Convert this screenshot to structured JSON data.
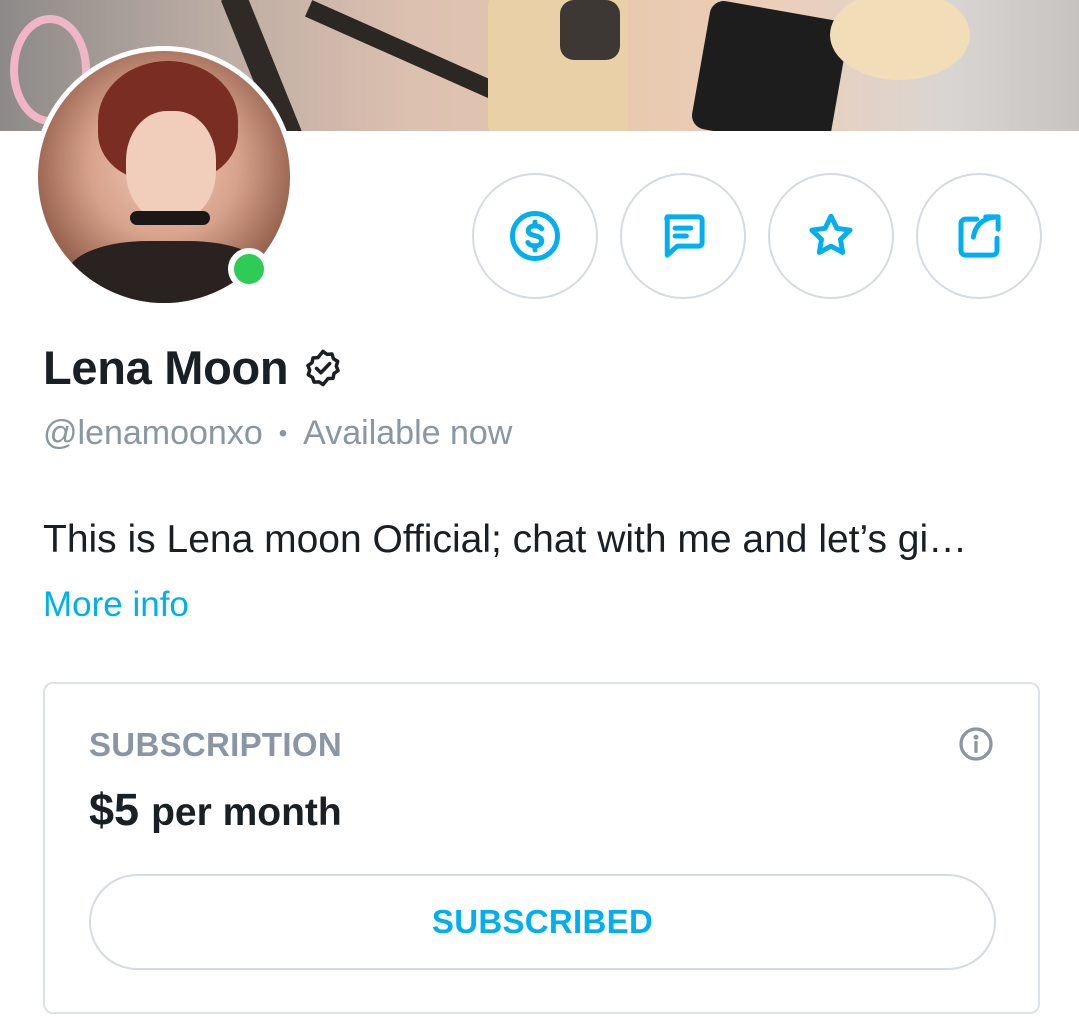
{
  "profile": {
    "name": "Lena Moon",
    "handle": "@lenamoonxo",
    "separator": "•",
    "status": "Available now",
    "bio": "This is Lena moon Official; chat with me and let’s gi…",
    "more_info": "More info",
    "online": true
  },
  "actions": [
    {
      "icon": "dollar-icon"
    },
    {
      "icon": "message-icon"
    },
    {
      "icon": "star-icon"
    },
    {
      "icon": "share-icon"
    }
  ],
  "subscription": {
    "title": "SUBSCRIPTION",
    "price": "$5",
    "period": "per month",
    "button_label": "SUBSCRIBED"
  },
  "colors": {
    "accent": "#00aff0",
    "online": "#2ecc57",
    "muted_text": "#8a96a3",
    "text": "#1a1f24",
    "border": "#d5dbe1"
  }
}
